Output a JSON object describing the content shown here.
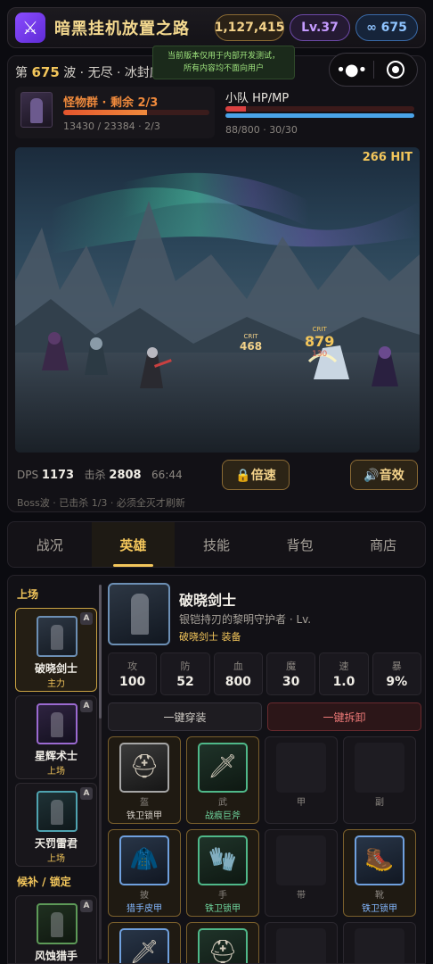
{
  "header": {
    "app_icon": "crossed-swords-icon",
    "app_icon_glyph": "⚔",
    "title": "暗黑挂机放置之路",
    "gold": "1,127,415",
    "level": "Lv.37",
    "gems": "∞ 675"
  },
  "notice": {
    "line1": "当前版本仅用于内部开发测试，",
    "line2": "所有内容均不面向用户"
  },
  "battle": {
    "wave_prefix": "第",
    "wave_number": "675",
    "wave_suffix": "波 · 无尽 · 冰封废土",
    "enemy": {
      "title": "怪物群 · 剩余 2/3",
      "stats": "13430 / 23384 · 2/3",
      "hp_fraction": 0.574
    },
    "party": {
      "title": "小队 HP/MP",
      "stats": "88/800 · 30/30",
      "hp_fraction": 0.11,
      "mp_fraction": 1.0
    },
    "hit_counter": "266 HIT",
    "floating": {
      "crit_label_1": "CRIT",
      "crit_value_1": "468",
      "crit_label_2": "CRIT",
      "crit_value_2": "879",
      "dmg_small": "130"
    },
    "dps_label": "DPS",
    "dps_value": "1173",
    "kills_label": "击杀",
    "kills_value": "2808",
    "timer": "66:44",
    "speed_button": "🔒倍速",
    "sound_button": "🔊音效",
    "boss_note": "Boss波 · 已击杀 1/3 · 必须全灭才刷新"
  },
  "tabs": [
    {
      "label": "战况",
      "active": false
    },
    {
      "label": "英雄",
      "active": true
    },
    {
      "label": "技能",
      "active": false
    },
    {
      "label": "背包",
      "active": false
    },
    {
      "label": "商店",
      "active": false
    }
  ],
  "roster": {
    "active_heading": "上场",
    "bench_heading": "候补 / 锁定",
    "heroes": [
      {
        "name": "破晓剑士",
        "role": "主力",
        "badge": "A"
      },
      {
        "name": "星辉术士",
        "role": "上场",
        "badge": "A"
      },
      {
        "name": "天罚雷君",
        "role": "上场",
        "badge": "A"
      },
      {
        "name": "风蚀猎手",
        "role": "",
        "badge": "A"
      }
    ]
  },
  "hero_detail": {
    "name": "破晓剑士",
    "desc": "银铠持刃的黎明守护者 · Lv.",
    "sub": "破晓剑士 装备",
    "stats": [
      {
        "label": "攻",
        "value": "100"
      },
      {
        "label": "防",
        "value": "52"
      },
      {
        "label": "血",
        "value": "800"
      },
      {
        "label": "魔",
        "value": "30"
      },
      {
        "label": "速",
        "value": "1.0"
      },
      {
        "label": "暴",
        "value": "9%"
      }
    ],
    "wear_all": "一键穿装",
    "strip_all": "一键拆卸",
    "slots": [
      {
        "type": "盔",
        "item": "铁卫锁甲",
        "rarity": "common",
        "glyph": "⛑"
      },
      {
        "type": "武",
        "item": "战痕巨斧",
        "rarity": "epic",
        "glyph": "🗡"
      },
      {
        "type": "甲",
        "item": "",
        "rarity": "empty",
        "glyph": ""
      },
      {
        "type": "副",
        "item": "",
        "rarity": "empty",
        "glyph": ""
      },
      {
        "type": "披",
        "item": "猎手皮甲",
        "rarity": "rare",
        "glyph": "🧥"
      },
      {
        "type": "手",
        "item": "铁卫锁甲",
        "rarity": "epic",
        "glyph": "🧤"
      },
      {
        "type": "带",
        "item": "",
        "rarity": "empty",
        "glyph": ""
      },
      {
        "type": "靴",
        "item": "铁卫锁甲",
        "rarity": "rare",
        "glyph": "🥾"
      },
      {
        "type": "",
        "item": "",
        "rarity": "rare",
        "glyph": "🗡"
      },
      {
        "type": "",
        "item": "",
        "rarity": "epic",
        "glyph": "⛑"
      },
      {
        "type": "",
        "item": "",
        "rarity": "empty",
        "glyph": ""
      },
      {
        "type": "",
        "item": "",
        "rarity": "empty",
        "glyph": ""
      }
    ]
  }
}
